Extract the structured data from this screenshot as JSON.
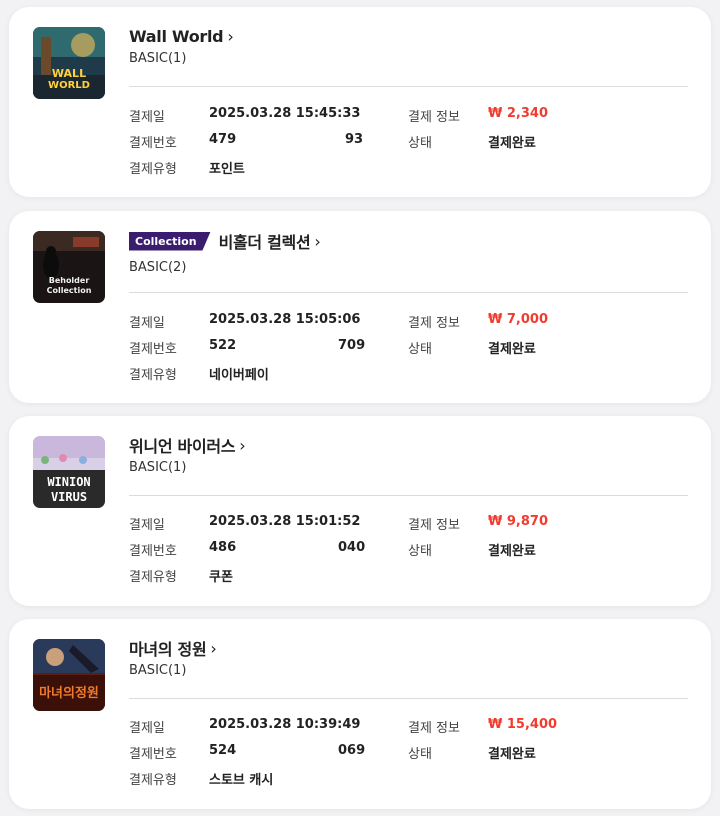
{
  "labels": {
    "date": "결제일",
    "order_no": "결제번호",
    "pay_type": "결제유형",
    "pay_info": "결제 정보",
    "status": "상태"
  },
  "orders": [
    {
      "title": "Wall World",
      "badge": "",
      "variant": "BASIC(1)",
      "date": "2025.03.28 15:45:33",
      "order_no_start": "479",
      "order_no_end": "93",
      "pay_type": "포인트",
      "price": "₩ 2,340",
      "status": "결제완료",
      "thumb_text": "Wall WORLD"
    },
    {
      "title": "비홀더 컬렉션",
      "badge": "Collection",
      "variant": "BASIC(2)",
      "date": "2025.03.28 15:05:06",
      "order_no_start": "522",
      "order_no_end": "709",
      "pay_type": "네이버페이",
      "price": "₩ 7,000",
      "status": "결제완료",
      "thumb_text": "Beholder Collection"
    },
    {
      "title": "위니언 바이러스",
      "badge": "",
      "variant": "BASIC(1)",
      "date": "2025.03.28 15:01:52",
      "order_no_start": "486",
      "order_no_end": "040",
      "pay_type": "쿠폰",
      "price": "₩ 9,870",
      "status": "결제완료",
      "thumb_text": "WINION VIRUS"
    },
    {
      "title": "마녀의 정원",
      "badge": "",
      "variant": "BASIC(1)",
      "date": "2025.03.28 10:39:49",
      "order_no_start": "524",
      "order_no_end": "069",
      "pay_type": "스토브 캐시",
      "price": "₩ 15,400",
      "status": "결제완료",
      "thumb_text": "마녀의정원"
    }
  ],
  "colors": {
    "price": "#f03c2e",
    "badge_bg": "#3b1d70",
    "background": "#f2f2f4"
  }
}
